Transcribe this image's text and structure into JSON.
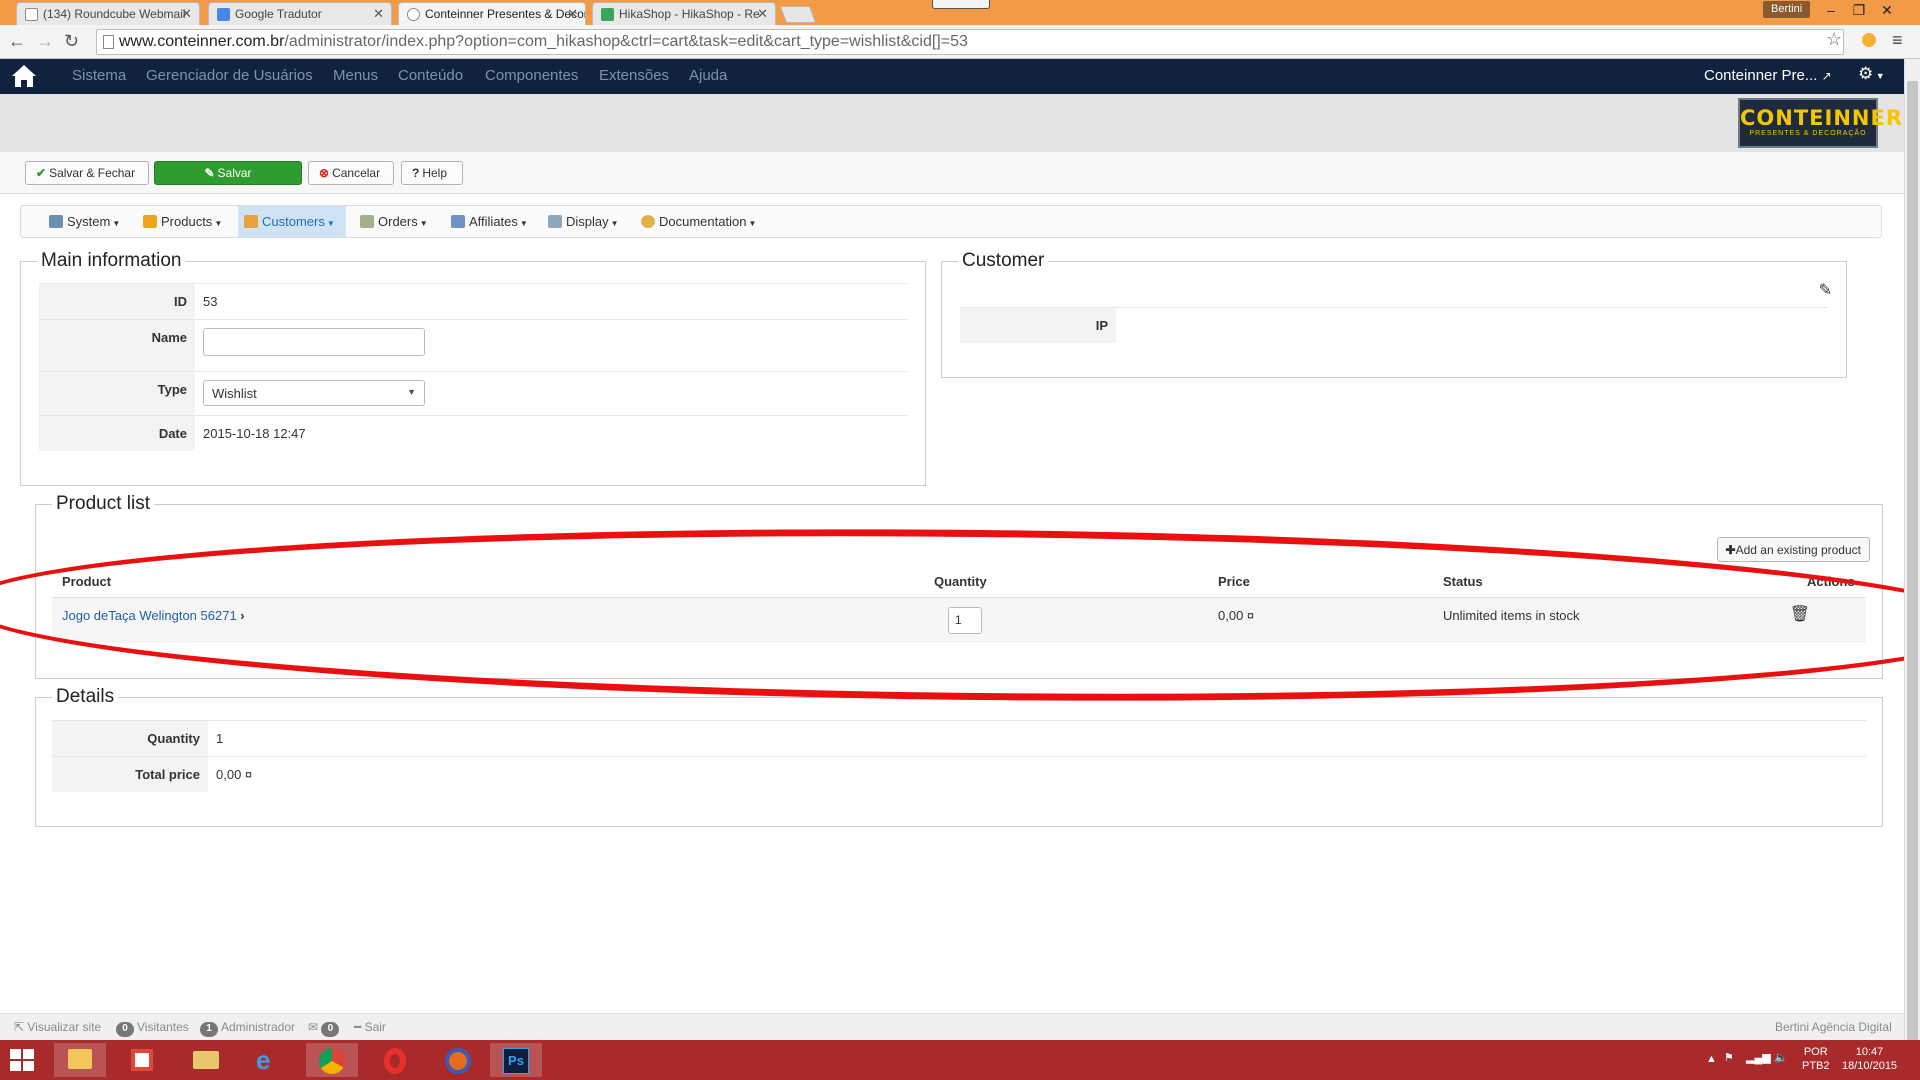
{
  "browser": {
    "tabs": [
      {
        "title": "(134) Roundcube Webmail",
        "active": false
      },
      {
        "title": "Google Tradutor",
        "active": false
      },
      {
        "title": "Conteinner Presentes & Decoração",
        "active": true
      },
      {
        "title": "HikaShop - HikaShop - Re",
        "active": false
      }
    ],
    "profile_name": "Bertini",
    "url_host": "www.conteinner.com.br",
    "url_path": "/administrator/index.php?option=com_hikashop&ctrl=cart&task=edit&cart_type=wishlist&cid[]=53"
  },
  "admin_nav": {
    "items": [
      "Sistema",
      "Gerenciador de Usuários",
      "Menus",
      "Conteúdo",
      "Componentes",
      "Extensões",
      "Ajuda"
    ],
    "site_name": "Conteinner Pre..."
  },
  "logo": {
    "brand": "CONTEINNER",
    "tagline": "PRESENTES & DECORAÇÃO"
  },
  "toolbar": {
    "save_close": "Salvar & Fechar",
    "save": "Salvar",
    "cancel": "Cancelar",
    "help": "Help"
  },
  "hikashop_menu": {
    "items": [
      {
        "label": "System",
        "icon": "wrench-icon"
      },
      {
        "label": "Products",
        "icon": "box-icon"
      },
      {
        "label": "Customers",
        "icon": "users-icon",
        "active": true
      },
      {
        "label": "Orders",
        "icon": "orders-icon"
      },
      {
        "label": "Affiliates",
        "icon": "affiliates-icon"
      },
      {
        "label": "Display",
        "icon": "display-icon"
      },
      {
        "label": "Documentation",
        "icon": "documentation-icon"
      }
    ]
  },
  "main_info": {
    "legend": "Main information",
    "id_label": "ID",
    "id_value": "53",
    "name_label": "Name",
    "name_value": "",
    "type_label": "Type",
    "type_value": "Wishlist",
    "date_label": "Date",
    "date_value": "2015-10-18 12:47"
  },
  "customer": {
    "legend": "Customer",
    "ip_label": "IP",
    "ip_value": ""
  },
  "product_list": {
    "legend": "Product list",
    "add_button": "Add an existing product",
    "headers": {
      "product": "Product",
      "quantity": "Quantity",
      "price": "Price",
      "status": "Status",
      "actions": "Actions"
    },
    "rows": [
      {
        "product": "Jogo deTaça Welington 56271",
        "quantity": "1",
        "price": "0,00 ¤",
        "status": "Unlimited items in stock"
      }
    ]
  },
  "details": {
    "legend": "Details",
    "quantity_label": "Quantity",
    "quantity_value": "1",
    "total_label": "Total price",
    "total_value": "0,00 ¤"
  },
  "footer": {
    "view_site": "Visualizar site",
    "visitors_count": "0",
    "visitors_label": "Visitantes",
    "admin_count": "1",
    "admin_label": "Administrador",
    "messages_count": "0",
    "logout": "Sair",
    "credit": "Bertini Agência Digital"
  },
  "taskbar": {
    "lang": "POR",
    "layout": "PTB2",
    "time": "10:47",
    "date": "18/10/2015"
  },
  "colors": {
    "admin_nav": "#10223e",
    "save_green": "#2e9c2e",
    "annotation_red": "#ea1010",
    "taskbar": "#a92a2a"
  }
}
